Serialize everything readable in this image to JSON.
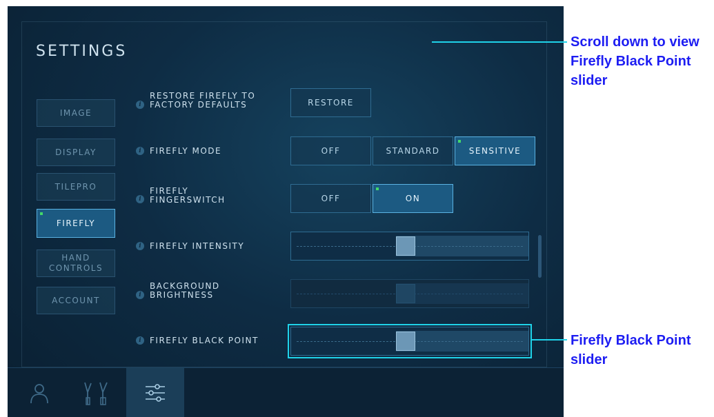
{
  "screen": {
    "title": "SETTINGS",
    "nav": [
      {
        "label": "IMAGE",
        "active": false
      },
      {
        "label": "DISPLAY",
        "active": false
      },
      {
        "label": "TILEPRO",
        "active": false
      },
      {
        "label": "FIREFLY",
        "active": true
      },
      {
        "label": "HAND\nCONTROLS",
        "active": false
      },
      {
        "label": "ACCOUNT",
        "active": false
      }
    ],
    "settings": {
      "restore": {
        "label": "RESTORE FIREFLY TO\nFACTORY DEFAULTS",
        "button": "RESTORE"
      },
      "mode": {
        "label": "FIREFLY MODE",
        "options": [
          "OFF",
          "STANDARD",
          "SENSITIVE"
        ],
        "selected": "SENSITIVE"
      },
      "fingerswitch": {
        "label": "FIREFLY\nFINGERSWITCH",
        "options": [
          "OFF",
          "ON"
        ],
        "selected": "ON"
      },
      "intensity": {
        "label": "FIREFLY INTENSITY",
        "value_fraction": 0.48
      },
      "background": {
        "label": "BACKGROUND\nBRIGHTNESS",
        "value_fraction": 0.48,
        "disabled": true
      },
      "black_point": {
        "label": "FIREFLY BLACK POINT",
        "value_fraction": 0.48
      }
    },
    "bottom_tabs": [
      {
        "icon": "user-icon",
        "active": false
      },
      {
        "icon": "instruments-icon",
        "active": false
      },
      {
        "icon": "sliders-icon",
        "active": true
      }
    ]
  },
  "callouts": {
    "scroll": "Scroll down to view\nFirefly Black Point\nslider",
    "black_point": "Firefly Black Point\nslider"
  },
  "colors": {
    "accent": "#1fd3ea",
    "callout_text": "#1d1df2",
    "indicator": "#43d86a"
  }
}
